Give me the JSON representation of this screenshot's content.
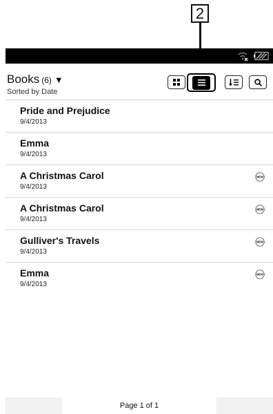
{
  "callout": {
    "number": "2"
  },
  "header": {
    "title": "Books",
    "count": "(6)",
    "dropdown_arrow": "▼",
    "subtitle": "Sorted by Date"
  },
  "toolbar": {
    "icons": [
      "grid-view-icon",
      "list-view-icon",
      "sort-icon",
      "search-icon"
    ]
  },
  "books": [
    {
      "title": "Pride and Prejudice",
      "date": "9/4/2013",
      "is_new": false
    },
    {
      "title": "Emma",
      "date": "9/4/2013",
      "is_new": false
    },
    {
      "title": "A Christmas Carol",
      "date": "9/4/2013",
      "is_new": true
    },
    {
      "title": "A Christmas Carol",
      "date": "9/4/2013",
      "is_new": true
    },
    {
      "title": "Gulliver's Travels",
      "date": "9/4/2013",
      "is_new": true
    },
    {
      "title": "Emma",
      "date": "9/4/2013",
      "is_new": true
    }
  ],
  "new_badge_label": "NEW",
  "footer": {
    "page_label": "Page 1 of 1"
  }
}
